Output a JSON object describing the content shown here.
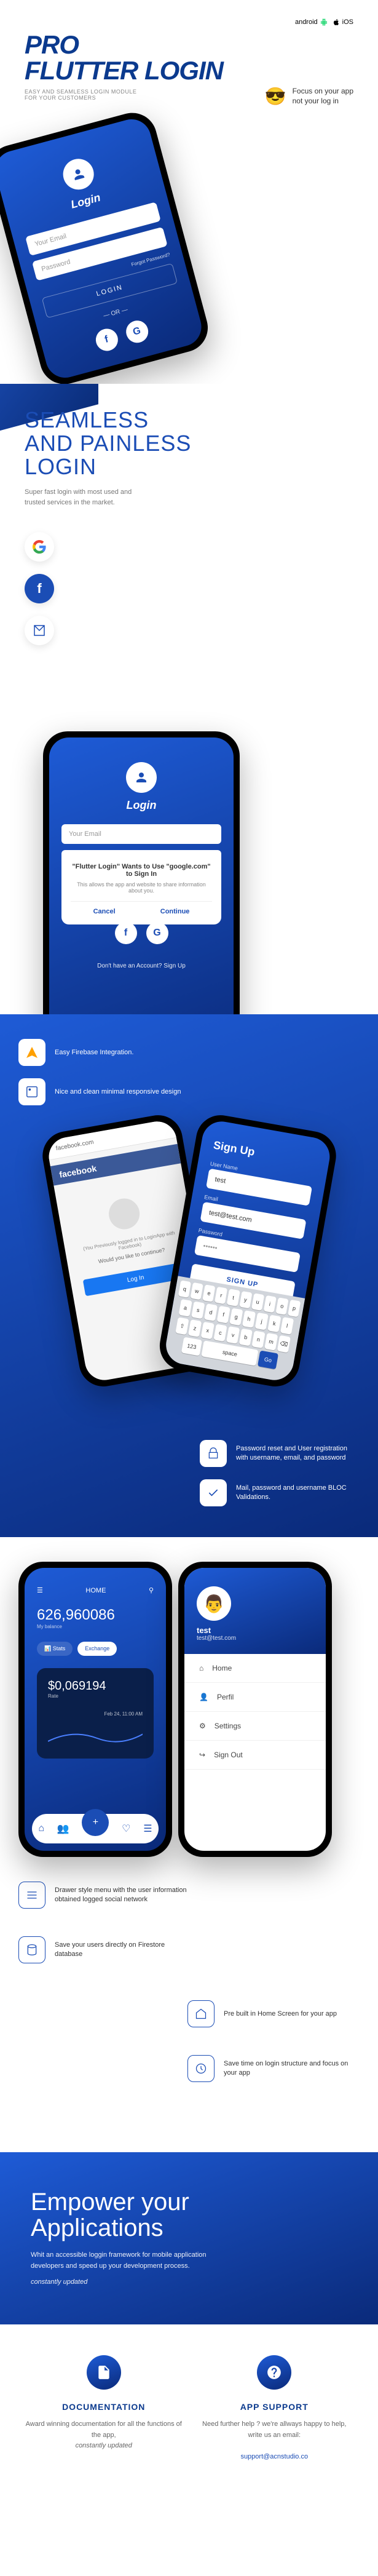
{
  "platforms": {
    "android": "android",
    "ios": "iOS"
  },
  "hero": {
    "title_line1": "PRO",
    "title_line2": "FLUTTER LOGIN",
    "subtitle": "EASY AND SEAMLESS LOGIN MODULE\nFOR YOUR CUSTOMERS",
    "blurb": "Focus on your app\nnot your log in"
  },
  "phone_login": {
    "title": "Login",
    "email_placeholder": "Your Email",
    "password_placeholder": "Password",
    "forgot": "Forgot Password?",
    "login_btn": "LOGIN",
    "or": "— OR —",
    "signup_prompt": "Don't have an Account? Sign Up"
  },
  "seamless": {
    "heading": "SEAMLESS\nAND PAINLESS\nLOGIN",
    "sub": "Super fast login with most used and trusted services in the market.",
    "modal_title": "\"Flutter Login\" Wants to Use \"google.com\" to Sign In",
    "modal_body": "This allows the app and website to share information about you.",
    "modal_cancel": "Cancel",
    "modal_continue": "Continue"
  },
  "features_top": [
    "Easy Firebase Integration.",
    "Nice and clean minimal responsive design"
  ],
  "fb_screen": {
    "header": "facebook.com",
    "brand": "facebook",
    "msg": "(You Previously logged in to LoginApp with Facebook)",
    "continue": "Would you like to continue?",
    "login_btn": "Log In"
  },
  "signup_screen": {
    "title": "Sign Up",
    "username_label": "User Name",
    "username_value": "test",
    "email_label": "Email",
    "email_value": "test@test.com",
    "password_label": "Password",
    "signup_btn": "SIGN UP"
  },
  "features_mid": [
    "Password reset and User registration with username, email, and password",
    "Mail, password and username BLOC Validations."
  ],
  "home_screen": {
    "title": "HOME",
    "balance": "626,960086",
    "balance_label": "My balance",
    "stats_btn": "Stats",
    "exchange_btn": "Exchange",
    "rate": "$0,069194",
    "rate_label": "Rate",
    "date": "Feb 24, 11:00 AM"
  },
  "drawer": {
    "name": "test",
    "email": "test@test.com",
    "items": [
      "Home",
      "Perfil",
      "Settings",
      "Sign Out"
    ]
  },
  "features_bottom_left": [
    "Drawer style menu with the user information obtained logged social network",
    "Save your users directly on Firestore database"
  ],
  "features_bottom_right": [
    "Pre built in Home Screen for your app",
    "Save time on login structure and focus on your app"
  ],
  "empower": {
    "heading": "Empower your\nApplications",
    "body": "Whit an accessible loggin framework for mobile application developers and speed up your development process.",
    "cta": "constantly updated"
  },
  "docs": {
    "doc_title": "DOCUMENTATION",
    "doc_body": "Award winning documentation for all the functions of the app,",
    "doc_em": "constantly updated",
    "support_title": "APP SUPPORT",
    "support_body": "Need further help ? we're allways happy to help, write us an email:",
    "support_email": "support@acnstudio.co"
  }
}
